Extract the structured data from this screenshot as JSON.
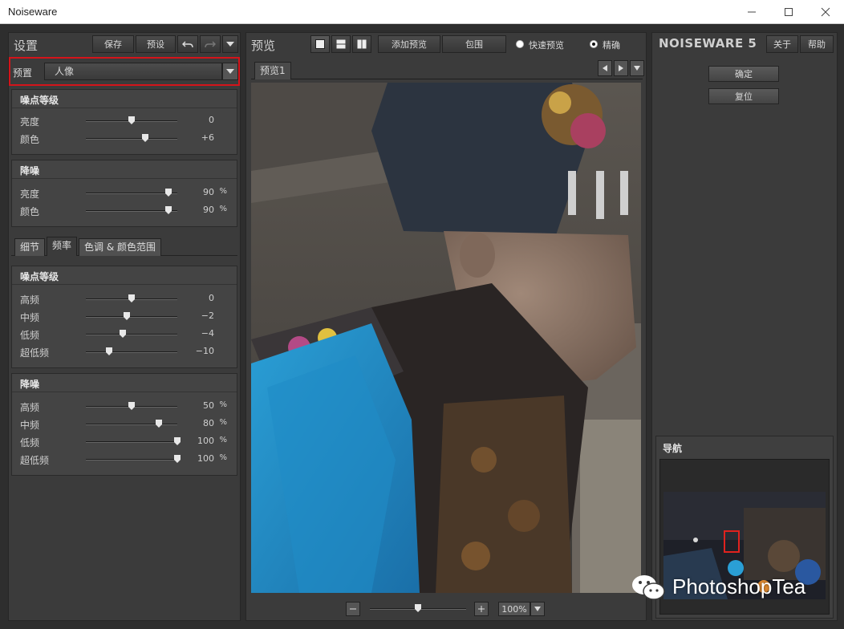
{
  "window": {
    "title": "Noiseware"
  },
  "left": {
    "header_title": "设置",
    "save_label": "保存",
    "preset_label": "预设",
    "preset_row_label": "预置",
    "preset_value": "人像",
    "noise_level": {
      "title": "噪点等级",
      "rows": [
        {
          "label": "亮度",
          "value": "0",
          "unit": "",
          "pos": 0.5
        },
        {
          "label": "颜色",
          "value": "+6",
          "unit": "",
          "pos": 0.65
        }
      ]
    },
    "noise_reduction": {
      "title": "降噪",
      "rows": [
        {
          "label": "亮度",
          "value": "90",
          "unit": "%",
          "pos": 0.9
        },
        {
          "label": "颜色",
          "value": "90",
          "unit": "%",
          "pos": 0.9
        }
      ]
    },
    "tabs": [
      "细节",
      "频率",
      "色调 & 颜色范围"
    ],
    "active_tab": "频率",
    "freq_noise_level": {
      "title": "噪点等级",
      "rows": [
        {
          "label": "高频",
          "value": "0",
          "unit": "",
          "pos": 0.5
        },
        {
          "label": "中频",
          "value": "−2",
          "unit": "",
          "pos": 0.45
        },
        {
          "label": "低频",
          "value": "−4",
          "unit": "",
          "pos": 0.4
        },
        {
          "label": "超低频",
          "value": "−10",
          "unit": "",
          "pos": 0.25
        }
      ]
    },
    "freq_noise_reduction": {
      "title": "降噪",
      "rows": [
        {
          "label": "高频",
          "value": "50",
          "unit": "%",
          "pos": 0.5
        },
        {
          "label": "中频",
          "value": "80",
          "unit": "%",
          "pos": 0.8
        },
        {
          "label": "低频",
          "value": "100",
          "unit": "%",
          "pos": 1.0
        },
        {
          "label": "超低频",
          "value": "100",
          "unit": "%",
          "pos": 1.0
        }
      ]
    }
  },
  "center": {
    "header_title": "预览",
    "add_preview_label": "添加预览",
    "envelope_label": "包围",
    "fast_preview_label": "快速预览",
    "accurate_label": "精确",
    "preview_tab": "预览1",
    "zoom_value": "100%",
    "zoom_pos": 0.5
  },
  "right": {
    "brand": "NOISEWARE 5",
    "about_label": "关于",
    "help_label": "帮助",
    "ok_label": "确定",
    "reset_label": "复位",
    "navigator_title": "导航"
  },
  "watermark": {
    "text": "PhotoshopTea"
  },
  "colors": {
    "highlight": "#d4141a",
    "panel": "#3b3b3b",
    "background": "#2e2e2e"
  }
}
